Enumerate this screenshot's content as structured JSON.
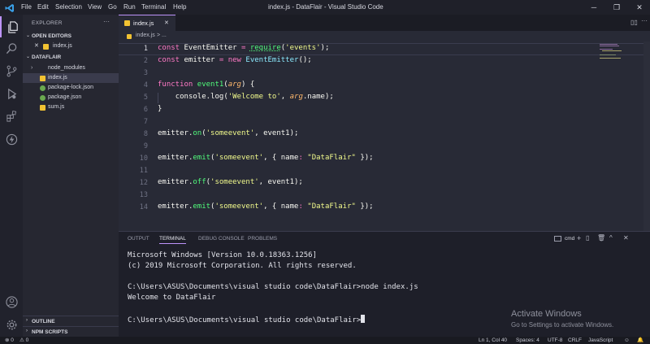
{
  "titlebar": {
    "menu": [
      "File",
      "Edit",
      "Selection",
      "View",
      "Go",
      "Run",
      "Terminal",
      "Help"
    ],
    "title": "index.js - DataFlair - Visual Studio Code",
    "minimize": "─",
    "maximize": "❐",
    "close": "✕"
  },
  "activity": [
    "explorer-icon",
    "search-icon",
    "source-control-icon",
    "run-debug-icon",
    "extensions-icon",
    "remote-icon",
    "account-icon",
    "manage-gear-icon"
  ],
  "sidebar": {
    "title": "EXPLORER",
    "more": "···",
    "open_editors": "OPEN EDITORS",
    "open_editor_close": "✕",
    "open_editor_file": "index.js",
    "folder": "DATAFLAIR",
    "files": [
      {
        "label": "node_modules",
        "chevron": "›"
      },
      {
        "label": "index.js"
      },
      {
        "label": "package-lock.json"
      },
      {
        "label": "package.json"
      },
      {
        "label": "sum.js"
      }
    ],
    "outline": "OUTLINE",
    "npm_scripts": "NPM SCRIPTS"
  },
  "editor": {
    "tab_label": "index.js",
    "tab_close": "✕",
    "breadcrumb_file": "index.js",
    "breadcrumb_more": "> ...",
    "more": "···",
    "line_numbers": [
      "1",
      "2",
      "3",
      "4",
      "5",
      "6",
      "7",
      "8",
      "9",
      "10",
      "11",
      "12",
      "13",
      "14"
    ],
    "lines": {
      "l1": {
        "const": "const ",
        "name": "EventEmitter",
        "eq": " = ",
        "req": "require",
        "open": "(",
        "str": "'events'",
        "close": ");"
      },
      "l2": {
        "const": "const ",
        "name": "emitter",
        "eq": " = ",
        "new": "new ",
        "cls": "EventEmitter",
        "rest": "();"
      },
      "l4": {
        "function": "function ",
        "name": "event1",
        "open": "(",
        "arg": "arg",
        "close": ") {"
      },
      "l5": {
        "indent": "    ",
        "obj": "console",
        "dot": ".",
        "fn": "log",
        "open": "(",
        "str": "'Welcome to'",
        "comma": ", ",
        "arg": "arg",
        "dot2": ".",
        "prop": "name",
        "close": ");"
      },
      "l6": {
        "text": "}"
      },
      "l8": {
        "obj": "emitter",
        "dot": ".",
        "fn": "on",
        "open": "(",
        "str": "'someevent'",
        "rest": ", event1);"
      },
      "l10": {
        "obj": "emitter",
        "dot": ".",
        "fn": "emit",
        "open": "(",
        "str": "'someevent'",
        "mid": ", { ",
        "key": "name",
        "colon": ": ",
        "str2": "\"DataFlair\"",
        "close": " });"
      },
      "l12": {
        "obj": "emitter",
        "dot": ".",
        "fn": "off",
        "open": "(",
        "str": "'someevent'",
        "rest": ", event1);"
      },
      "l14": {
        "obj": "emitter",
        "dot": ".",
        "fn": "emit",
        "open": "(",
        "str": "'someevent'",
        "mid": ", { ",
        "key": "name",
        "colon": ": ",
        "str2": "\"DataFlair\"",
        "close": " });"
      }
    }
  },
  "panel": {
    "tabs": [
      "OUTPUT",
      "TERMINAL",
      "DEBUG CONSOLE",
      "PROBLEMS"
    ],
    "terminal_select": "cmd",
    "lines": [
      "Microsoft Windows [Version 10.0.18363.1256]",
      "(c) 2019 Microsoft Corporation. All rights reserved.",
      "",
      "C:\\Users\\ASUS\\Documents\\visual studio code\\DataFlair>node index.js",
      "Welcome to DataFlair",
      "",
      "C:\\Users\\ASUS\\Documents\\visual studio code\\DataFlair>"
    ]
  },
  "watermark": {
    "title": "Activate Windows",
    "subtitle": "Go to Settings to activate Windows."
  },
  "statusbar": {
    "errors": "⊗ 0",
    "warnings": "⚠ 0",
    "position": "Ln 1, Col 40",
    "spaces": "Spaces: 4",
    "encoding": "UTF-8",
    "eol": "CRLF",
    "language": "JavaScript"
  },
  "colors": {
    "accent": "#bd93f9",
    "keyword": "#ff79c6",
    "string": "#f1fa8c",
    "function": "#50fa7b",
    "class": "#8be9fd",
    "param": "#ffb86c"
  }
}
